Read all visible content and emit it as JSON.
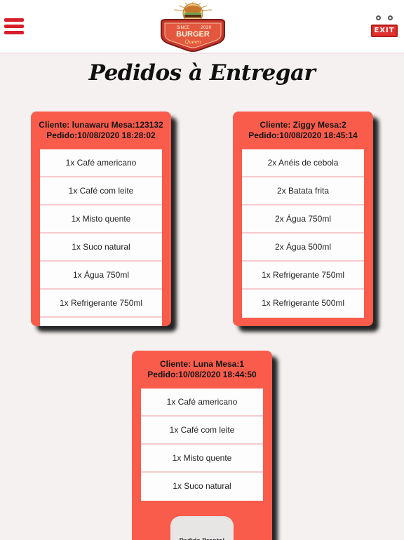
{
  "header": {
    "menu_icon": "hamburger-menu-icon",
    "logo": {
      "since_text": "SINCE",
      "year_text": "2020",
      "brand_text": "BURGER",
      "sub_text": "Queen"
    },
    "exit_label": "EXIT"
  },
  "page_title": "Pedidos à Entregar",
  "colors": {
    "card_bg": "#fa5c4c",
    "menu_red": "#d81e2a",
    "page_bg": "#f5f1f1"
  },
  "orders": [
    {
      "client": "Cliente: lunawaru Mesa:123132",
      "date": "Pedido:10/08/2020 18:28:02",
      "items": [
        "1x Café americano",
        "1x Café com leite",
        "1x Misto quente",
        "1x Suco natural",
        "1x Água 750ml",
        "1x Refrigerante 750ml"
      ]
    },
    {
      "client": "Cliente: Ziggy Mesa:2",
      "date": "Pedido:10/08/2020 18:45:14",
      "items": [
        "2x Anéis de cebola",
        "2x Batata frita",
        "2x Água 750ml",
        "2x Água 500ml",
        "1x Refrigerante 750ml",
        "1x Refrigerante 500ml"
      ]
    },
    {
      "client": "Cliente: Luna Mesa:1",
      "date": "Pedido:10/08/2020 18:44:50",
      "items": [
        "1x Café americano",
        "1x Café com leite",
        "1x Misto quente",
        "1x Suco natural"
      ],
      "ready_button": "Pedido Pronto!"
    }
  ]
}
